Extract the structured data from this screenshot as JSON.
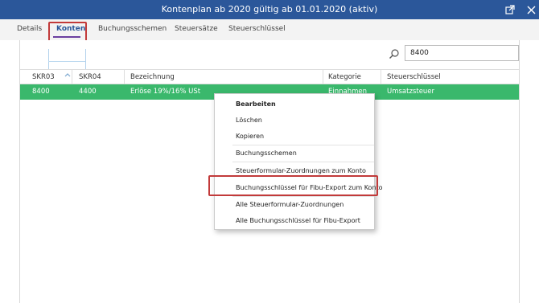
{
  "window": {
    "title": "Kontenplan ab 2020 gültig ab 01.01.2020 (aktiv)"
  },
  "tabs": [
    {
      "label": "Details"
    },
    {
      "label": "Konten"
    },
    {
      "label": "Buchungsschemen"
    },
    {
      "label": "Steuersätze"
    },
    {
      "label": "Steuerschlüssel"
    }
  ],
  "search": {
    "value": "8400"
  },
  "table": {
    "headers": [
      "SKR03",
      "SKR04",
      "Bezeichnung",
      "Kategorie",
      "Steuerschlüssel"
    ],
    "rows": [
      {
        "skr03": "8400",
        "skr04": "4400",
        "bezeichnung": "Erlöse 19%/16% USt",
        "kategorie": "Einnahmen",
        "steuerschluessel": "Umsatzsteuer"
      }
    ]
  },
  "context_menu": {
    "items": [
      "Bearbeiten",
      "Löschen",
      "Kopieren",
      "Buchungsschemen",
      "Steuerformular-Zuordnungen zum Konto",
      "Buchungsschlüssel für Fibu-Export zum Konto",
      "Alle Steuerformular-Zuordnungen",
      "Alle Buchungsschlüssel für Fibu-Export"
    ]
  },
  "colors": {
    "titlebar": "#2b579a",
    "selected_row": "#3ab86c",
    "highlight_box": "#c23a3a",
    "active_tab_underline": "#6a3fa0"
  }
}
